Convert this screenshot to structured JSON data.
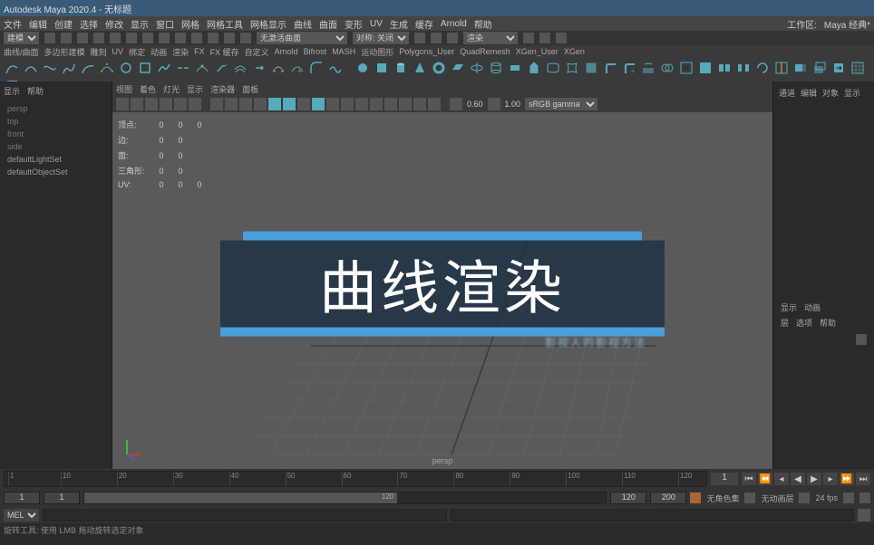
{
  "title_bar": "Autodesk Maya 2020.4 - 无标题",
  "menu": [
    "文件",
    "编辑",
    "创建",
    "选择",
    "修改",
    "显示",
    "窗口",
    "网格",
    "网格工具",
    "网格显示",
    "曲线",
    "曲面",
    "变形",
    "UV",
    "生成",
    "缓存",
    "Arnold",
    "帮助"
  ],
  "menu_right": {
    "workspace": "工作区:",
    "workspace_val": "Maya 经典*"
  },
  "status": {
    "mode": "建模",
    "search_placeholder": "无激活曲面",
    "sym": "对称: 关闭"
  },
  "shelf_tabs": [
    "曲线/曲面",
    "多边形建模",
    "雕刻",
    "UV",
    "绑定",
    "动画",
    "渲染",
    "FX",
    "FX 缓存",
    "自定义",
    "Arnold",
    "Bifrost",
    "MASH",
    "运动图形",
    "Polygons_User",
    "QuadRemesh",
    "XGen_User",
    "XGen"
  ],
  "outliner": {
    "tabs": [
      "显示",
      "帮助"
    ],
    "items": [
      "persp",
      "top",
      "front",
      "side",
      "defaultLightSet",
      "defaultObjectSet"
    ]
  },
  "viewport_menu": [
    "视图",
    "着色",
    "灯光",
    "显示",
    "渲染器",
    "面板"
  ],
  "viewport_nums": {
    "a": "0.60",
    "b": "1.00"
  },
  "viewport_renderer": "sRGB gamma",
  "hud": {
    "rows": [
      [
        "顶点:",
        "0",
        "0",
        "0"
      ],
      [
        "边:",
        "0",
        "0",
        ""
      ],
      [
        "面:",
        "0",
        "0",
        ""
      ],
      [
        "三角形:",
        "0",
        "0",
        ""
      ],
      [
        "UV:",
        "0",
        "0",
        "0"
      ]
    ]
  },
  "camera": "persp",
  "overlay": {
    "title": "曲线渲染",
    "sub": "影视人的影视方法"
  },
  "right_panel": {
    "tabs": [
      "通道",
      "编辑",
      "对象",
      "显示"
    ],
    "section": {
      "l1": [
        "显示",
        "动画"
      ],
      "l2": [
        "层",
        "选项",
        "帮助"
      ]
    }
  },
  "timeline": {
    "ticks": [
      1,
      10,
      20,
      30,
      40,
      50,
      60,
      70,
      80,
      90,
      100,
      110,
      120
    ],
    "current": "1"
  },
  "range": {
    "start": "1",
    "in": "1",
    "out": "120",
    "end": "200",
    "nokey": "无角色集",
    "noanim": "无动画层",
    "fps": "24 fps"
  },
  "cmd": {
    "mode": "MEL"
  },
  "help": "旋转工具: 使用 LMB 拖动旋转选定对象"
}
